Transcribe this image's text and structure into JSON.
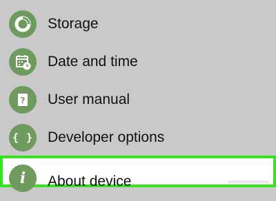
{
  "settings_list": {
    "items": [
      {
        "label": "Storage",
        "icon": "storage-icon"
      },
      {
        "label": "Date and time",
        "icon": "calendar-clock-icon"
      },
      {
        "label": "User manual",
        "icon": "help-book-icon"
      },
      {
        "label": "Developer options",
        "icon": "braces-icon",
        "glyph": "{ }"
      },
      {
        "label": "About device",
        "icon": "info-icon",
        "glyph": "i",
        "selected": true
      }
    ]
  },
  "colors": {
    "background": "#c9c9c9",
    "icon_circle": "#6f9a5e",
    "highlight_border": "#35e21f",
    "selected_row": "#ffffff"
  }
}
